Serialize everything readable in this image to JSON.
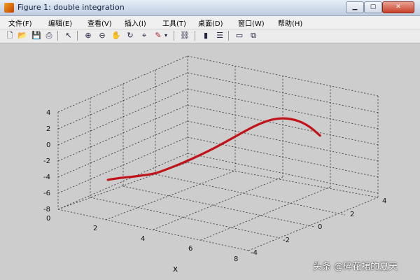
{
  "window": {
    "title": "Figure 1: double integration"
  },
  "menu": [
    {
      "label": "文件(F)"
    },
    {
      "label": "编辑(E)"
    },
    {
      "label": "查看(V)"
    },
    {
      "label": "插入(I)"
    },
    {
      "label": "工具(T)"
    },
    {
      "label": "桌面(D)"
    },
    {
      "label": "窗口(W)"
    },
    {
      "label": "帮助(H)"
    }
  ],
  "toolbar": {
    "icons": [
      "new-file-icon",
      "open-folder-icon",
      "save-icon",
      "print-icon",
      "pointer-icon",
      "zoom-in-icon",
      "zoom-out-icon",
      "pan-hand-icon",
      "rotate-3d-icon",
      "data-cursor-icon",
      "brush-icon",
      "dropdown-arrow-icon",
      "link-plot-icon",
      "colorbar-icon",
      "legend-icon",
      "hide-plot-tools-icon",
      "show-plot-tools-icon"
    ]
  },
  "chart_data": {
    "type": "line",
    "title": "",
    "xlabel": "x",
    "ylabel": "",
    "zlabel": "",
    "xlim": [
      0,
      8
    ],
    "ylim": [
      -4,
      4
    ],
    "zlim": [
      -8,
      4
    ],
    "x_ticks": [
      "0",
      "2",
      "4",
      "6",
      "8"
    ],
    "y_ticks": [
      "4",
      "2",
      "0",
      "-2",
      "-4"
    ],
    "z_ticks": [
      "4",
      "2",
      "0",
      "-2",
      "-4",
      "-6",
      "-8"
    ],
    "grid": true,
    "line_color": "#c0141a",
    "series": [
      {
        "x": [
          0.05,
          0.25,
          0.55,
          0.95,
          1.35,
          1.85,
          2.3,
          2.85,
          3.45,
          4.05,
          4.6,
          5.1,
          5.6,
          6.05,
          6.5,
          6.95,
          7.3
        ],
        "y": [
          -1.0,
          -0.95,
          -0.9,
          -0.8,
          -0.75,
          -0.7,
          -0.6,
          -0.45,
          -0.3,
          -0.15,
          -0.02,
          0.12,
          0.28,
          0.5,
          0.8,
          1.15,
          1.45
        ],
        "z": [
          -6.5,
          -6.3,
          -6.0,
          -5.7,
          -5.3,
          -4.8,
          -4.0,
          -3.0,
          -1.8,
          -0.5,
          0.8,
          2.0,
          3.1,
          3.8,
          3.9,
          3.2,
          1.8
        ]
      }
    ]
  },
  "watermark": "头条 @碎花裙的夏天"
}
